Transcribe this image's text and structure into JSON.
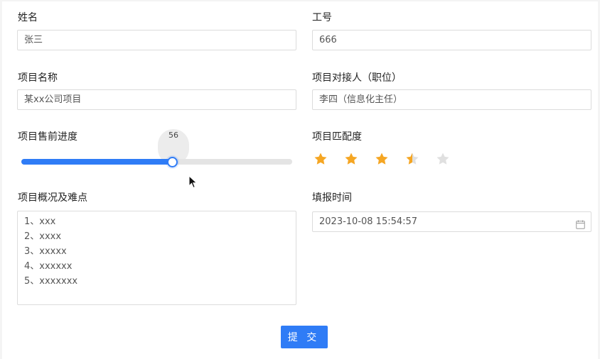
{
  "form": {
    "name": {
      "label": "姓名",
      "value": "张三"
    },
    "employee_id": {
      "label": "工号",
      "value": "666"
    },
    "project_name": {
      "label": "项目名称",
      "value": "某xx公司项目"
    },
    "project_contact": {
      "label": "项目对接人（职位）",
      "value": "李四（信息化主任）"
    },
    "presale_progress": {
      "label": "项目售前进度",
      "value": 56,
      "tooltip": "56",
      "max": 100
    },
    "match_rating": {
      "label": "项目匹配度",
      "value": 3.5,
      "max": 5
    },
    "overview": {
      "label": "项目概况及难点",
      "lines": [
        "1、xxx",
        "2、xxxx",
        "3、xxxxx",
        "4、xxxxxx",
        "5、xxxxxxx"
      ]
    },
    "fill_time": {
      "label": "填报时间",
      "value": "2023-10-08 15:54:57",
      "icon": "calendar-icon"
    },
    "submit_label": "提 交"
  },
  "colors": {
    "primary": "#2f7cf6",
    "star_on": "#f5a623",
    "star_off": "#e0e0e0"
  }
}
